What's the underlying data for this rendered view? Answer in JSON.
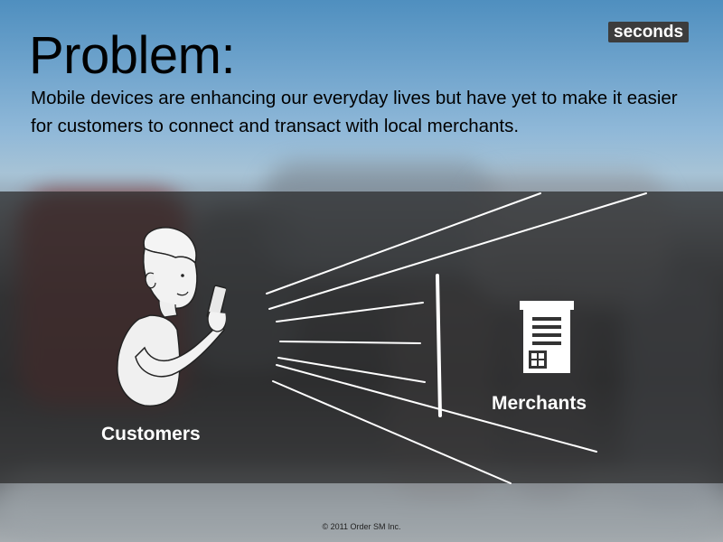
{
  "slide": {
    "title": "Problem:",
    "subtitle": "Mobile devices are enhancing our everyday lives but have yet to make it easier for customers to connect and transact with local merchants.",
    "logo_text": "seconds",
    "customers_label": "Customers",
    "merchants_label": "Merchants",
    "footer": "© 2011 Order SM Inc."
  },
  "icons": {
    "person": "person-with-phone-sketch",
    "building": "building-icon"
  },
  "colors": {
    "overlay_band": "#282828",
    "label_text": "#ffffff",
    "logo_bg": "#3c3c3c"
  }
}
